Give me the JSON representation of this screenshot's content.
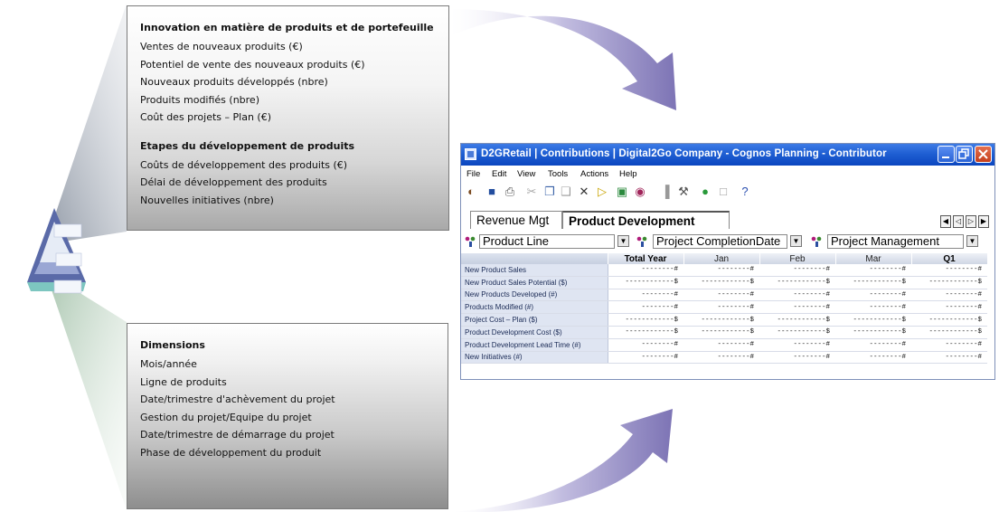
{
  "top_panel": {
    "heading1": "Innovation en matière de produits et de portefeuille",
    "lines1": [
      "Ventes de nouveaux produits (€)",
      "Potentiel de vente des nouveaux produits (€)",
      "Nouveaux produits développés (nbre)",
      "Produits modifiés (nbre)",
      "Coût des projets – Plan (€)"
    ],
    "heading2": "Etapes du développement de produits",
    "lines2": [
      "Coûts de développement des produits (€)",
      "Délai de développement des produits",
      "Nouvelles initiatives (nbre)"
    ]
  },
  "bottom_panel": {
    "heading": "Dimensions",
    "lines": [
      "Mois/année",
      "Ligne de produits",
      "Date/trimestre d'achèvement du projet",
      "Gestion du projet/Equipe du projet",
      "Date/trimestre de démarrage du projet",
      "Phase de développement du produit"
    ]
  },
  "window": {
    "title": "D2GRetail | Contributions | Digital2Go Company - Cognos Planning - Contributor",
    "menu": {
      "file": "File",
      "edit": "Edit",
      "view": "View",
      "tools": "Tools",
      "actions": "Actions",
      "help": "Help"
    },
    "tabs": {
      "revenue": "Revenue Mgt",
      "product": "Product Development"
    },
    "dimensions": {
      "product_line": "Product Line",
      "completion_date": "Project CompletionDate",
      "management": "Project Management"
    },
    "grid": {
      "columns": [
        "Total Year",
        "Jan",
        "Feb",
        "Mar",
        "Q1"
      ],
      "rows": [
        {
          "label": "New Product Sales",
          "cells": [
            "--------#",
            "--------#",
            "--------#",
            "--------#",
            "--------#"
          ]
        },
        {
          "label": "New Product Sales Potential ($)",
          "cells": [
            "------------$",
            "------------$",
            "------------$",
            "------------$",
            "------------$"
          ]
        },
        {
          "label": "New Products Developed (#)",
          "cells": [
            "--------#",
            "--------#",
            "--------#",
            "--------#",
            "--------#"
          ]
        },
        {
          "label": "Products Modified (#)",
          "cells": [
            "--------#",
            "--------#",
            "--------#",
            "--------#",
            "--------#"
          ]
        },
        {
          "label": "Project Cost – Plan ($)",
          "cells": [
            "------------$",
            "------------$",
            "------------$",
            "------------$",
            "------------$"
          ]
        },
        {
          "label": "Product Development Cost ($)",
          "cells": [
            "------------$",
            "------------$",
            "------------$",
            "------------$",
            "------------$"
          ]
        },
        {
          "label": "Product Development Lead Time (#)",
          "cells": [
            "--------#",
            "--------#",
            "--------#",
            "--------#",
            "--------#"
          ]
        },
        {
          "label": "New Initiatives (#)",
          "cells": [
            "--------#",
            "--------#",
            "--------#",
            "--------#",
            "--------#"
          ]
        }
      ]
    }
  },
  "colors": {
    "titlebar": "#1f5fd3",
    "arrow": "#8e84bc",
    "beam_top": "#9aa3b2",
    "beam_bottom": "#bfd3c3"
  }
}
